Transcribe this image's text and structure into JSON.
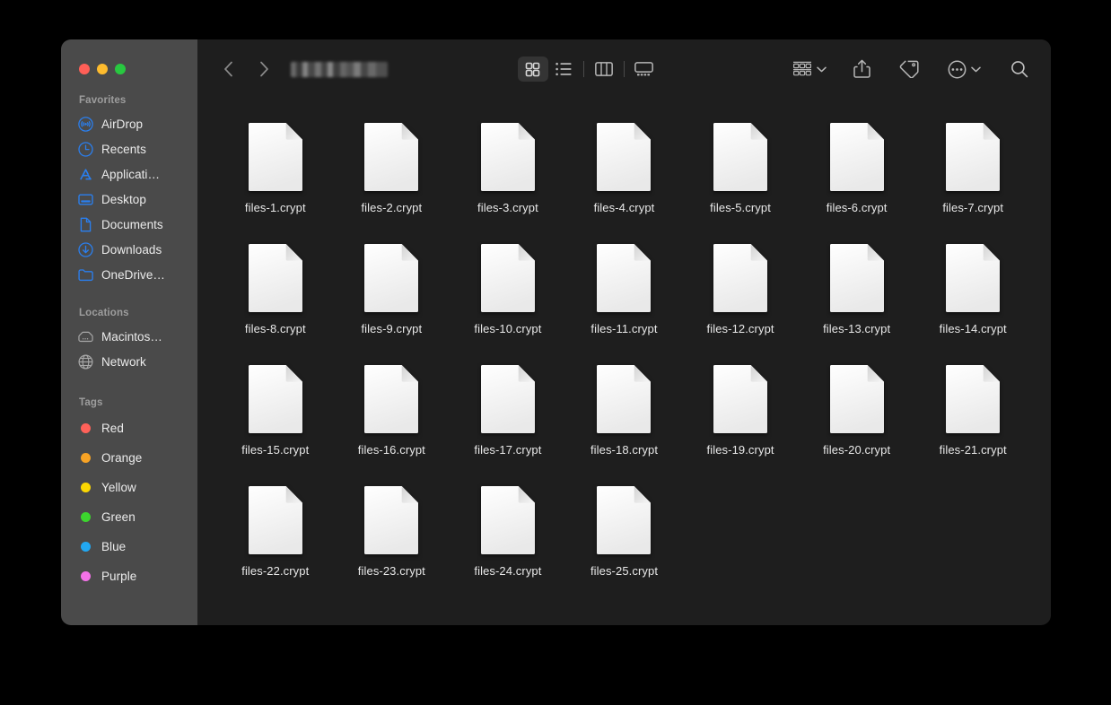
{
  "window": {
    "title_redacted": true,
    "traffic_lights": [
      {
        "name": "close",
        "color": "#ff5f57"
      },
      {
        "name": "minimize",
        "color": "#febc2e"
      },
      {
        "name": "maximize",
        "color": "#28c840"
      }
    ]
  },
  "sidebar": {
    "sections": [
      {
        "title": "Favorites",
        "items": [
          {
            "label": "AirDrop",
            "icon": "airdrop-icon",
            "color": "#2a7fef"
          },
          {
            "label": "Recents",
            "icon": "clock-icon",
            "color": "#2a7fef"
          },
          {
            "label": "Applicati…",
            "icon": "applications-icon",
            "color": "#2a7fef"
          },
          {
            "label": "Desktop",
            "icon": "desktop-icon",
            "color": "#2a7fef"
          },
          {
            "label": "Documents",
            "icon": "document-icon",
            "color": "#2a7fef"
          },
          {
            "label": "Downloads",
            "icon": "download-icon",
            "color": "#2a7fef"
          },
          {
            "label": "OneDrive…",
            "icon": "folder-icon",
            "color": "#2a7fef"
          }
        ]
      },
      {
        "title": "Locations",
        "items": [
          {
            "label": "Macintos…",
            "icon": "hard-drive-icon",
            "color": "#a8a8a8"
          },
          {
            "label": "Network",
            "icon": "globe-icon",
            "color": "#a8a8a8"
          }
        ]
      }
    ],
    "tags_title": "Tags",
    "tags": [
      {
        "label": "Red",
        "color": "#ff6159"
      },
      {
        "label": "Orange",
        "color": "#f7a325"
      },
      {
        "label": "Yellow",
        "color": "#fbd702"
      },
      {
        "label": "Green",
        "color": "#3cd52e"
      },
      {
        "label": "Blue",
        "color": "#22a8f2"
      },
      {
        "label": "Purple",
        "color": "#f472e8"
      }
    ]
  },
  "toolbar": {
    "back_label": "Back",
    "forward_label": "Forward",
    "path_label": "",
    "view_buttons": [
      {
        "name": "icon-view",
        "label": "as Icons",
        "active": true
      },
      {
        "name": "list-view",
        "label": "as List",
        "active": false
      },
      {
        "name": "column-view",
        "label": "as Columns",
        "active": false
      },
      {
        "name": "gallery-view",
        "label": "as Gallery",
        "active": false
      }
    ],
    "group_label": "Group",
    "share_label": "Share",
    "tags_label": "Tags",
    "more_label": "More",
    "search_label": "Search"
  },
  "files": [
    {
      "name": "files-1.crypt"
    },
    {
      "name": "files-2.crypt"
    },
    {
      "name": "files-3.crypt"
    },
    {
      "name": "files-4.crypt"
    },
    {
      "name": "files-5.crypt"
    },
    {
      "name": "files-6.crypt"
    },
    {
      "name": "files-7.crypt"
    },
    {
      "name": "files-8.crypt"
    },
    {
      "name": "files-9.crypt"
    },
    {
      "name": "files-10.crypt"
    },
    {
      "name": "files-11.crypt"
    },
    {
      "name": "files-12.crypt"
    },
    {
      "name": "files-13.crypt"
    },
    {
      "name": "files-14.crypt"
    },
    {
      "name": "files-15.crypt"
    },
    {
      "name": "files-16.crypt"
    },
    {
      "name": "files-17.crypt"
    },
    {
      "name": "files-18.crypt"
    },
    {
      "name": "files-19.crypt"
    },
    {
      "name": "files-20.crypt"
    },
    {
      "name": "files-21.crypt"
    },
    {
      "name": "files-22.crypt"
    },
    {
      "name": "files-23.crypt"
    },
    {
      "name": "files-24.crypt"
    },
    {
      "name": "files-25.crypt"
    }
  ],
  "colors": {
    "sidebar_bg": "#4a4a4a",
    "content_bg": "#1e1e1e",
    "accent_blue": "#2a7fef",
    "text_primary": "#ebebeb",
    "text_secondary": "#9d9d9d"
  }
}
